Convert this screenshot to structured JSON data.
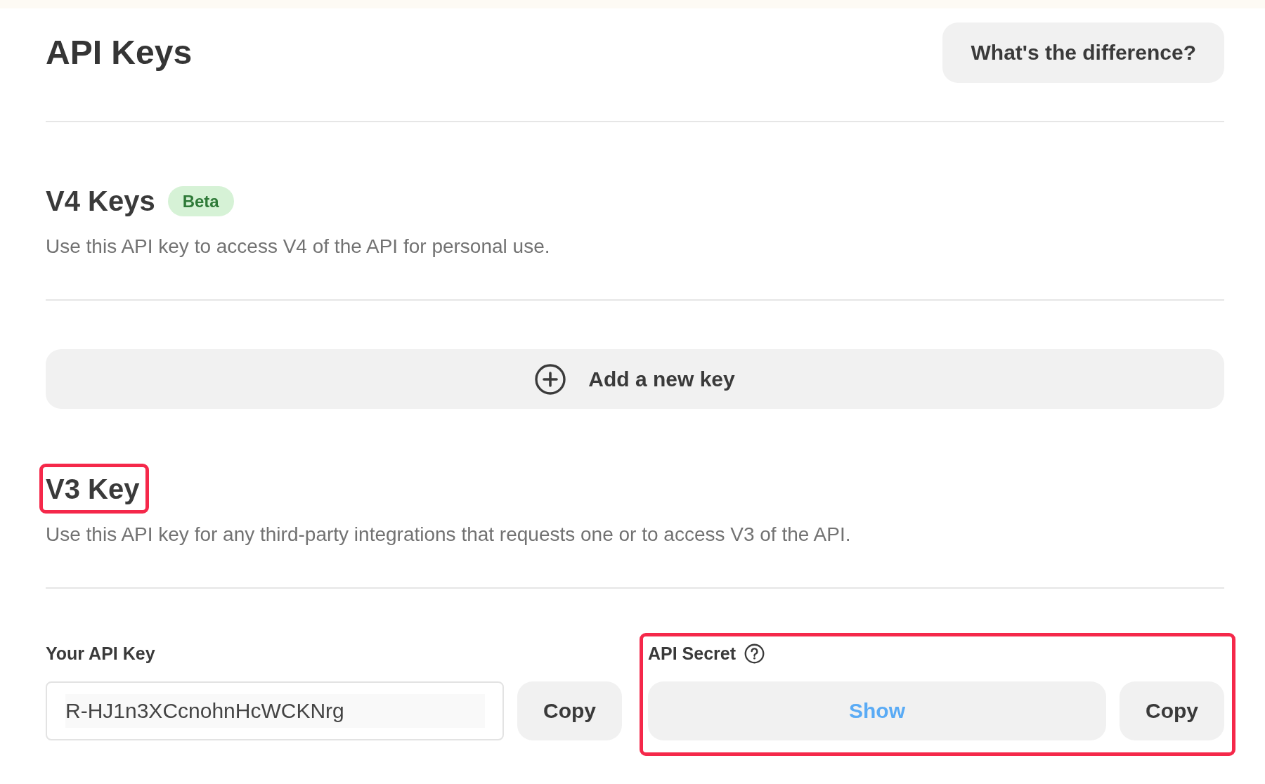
{
  "header": {
    "title": "API Keys",
    "difference_button": "What's the difference?"
  },
  "v4_section": {
    "heading": "V4 Keys",
    "badge": "Beta",
    "description": "Use this API key to access V4 of the API for personal use.",
    "add_button": "Add a new key"
  },
  "v3_section": {
    "heading": "V3 Key",
    "heading_highlighted": true,
    "description": "Use this API key for any third-party integrations that requests one or to access V3 of the API.",
    "api_key": {
      "label": "Your API Key",
      "value": "R-HJ1n3XCcnohnHcWCKNrg",
      "copy_button": "Copy"
    },
    "api_secret": {
      "label": "API Secret",
      "show_button": "Show",
      "copy_button": "Copy",
      "highlighted": true
    }
  }
}
